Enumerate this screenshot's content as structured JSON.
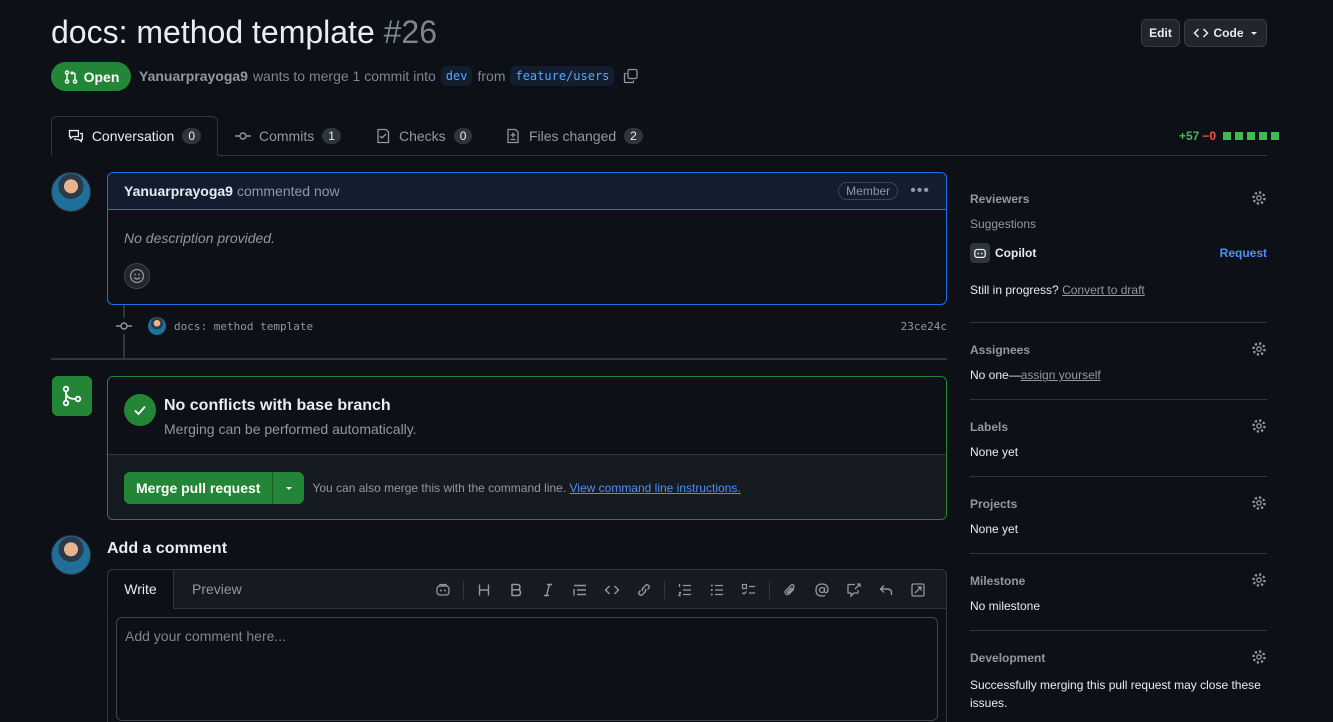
{
  "header": {
    "title": "docs: method template",
    "number": "#26",
    "edit_label": "Edit",
    "code_label": "Code",
    "state": "Open",
    "author": "Yanuarprayoga9",
    "merge_text": "wants to merge 1 commit into",
    "base_branch": "dev",
    "from_text": "from",
    "head_branch": "feature/users"
  },
  "tabs": [
    {
      "label": "Conversation",
      "count": "0",
      "icon": "comment-discussion-icon"
    },
    {
      "label": "Commits",
      "count": "1",
      "icon": "git-commit-icon"
    },
    {
      "label": "Checks",
      "count": "0",
      "icon": "checklist-icon"
    },
    {
      "label": "Files changed",
      "count": "2",
      "icon": "file-diff-icon"
    }
  ],
  "diffstat": {
    "additions": "+57",
    "deletions": "−0"
  },
  "comment": {
    "author": "Yanuarprayoga9",
    "when": "commented now",
    "role": "Member",
    "body": "No description provided."
  },
  "commit": {
    "message": "docs: method template",
    "sha": "23ce24c"
  },
  "merge": {
    "title": "No conflicts with base branch",
    "subtitle": "Merging can be performed automatically.",
    "button_label": "Merge pull request",
    "hint": "You can also merge this with the command line.",
    "hint_link": "View command line instructions."
  },
  "add_comment": {
    "title": "Add a comment",
    "write_tab": "Write",
    "preview_tab": "Preview",
    "placeholder": "Add your comment here..."
  },
  "sidebar": {
    "reviewers": {
      "heading": "Reviewers",
      "suggestions": "Suggestions",
      "suggested": "Copilot",
      "request": "Request",
      "progress": "Still in progress?",
      "convert": "Convert to draft"
    },
    "assignees": {
      "heading": "Assignees",
      "value": "No one—",
      "link": "assign yourself"
    },
    "labels": {
      "heading": "Labels",
      "value": "None yet"
    },
    "projects": {
      "heading": "Projects",
      "value": "None yet"
    },
    "milestone": {
      "heading": "Milestone",
      "value": "No milestone"
    },
    "development": {
      "heading": "Development",
      "value": "Successfully merging this pull request may close these issues."
    }
  },
  "colors": {
    "accent": "#1f6feb",
    "success": "#238636",
    "danger": "#f85149",
    "background": "#0d1117"
  }
}
